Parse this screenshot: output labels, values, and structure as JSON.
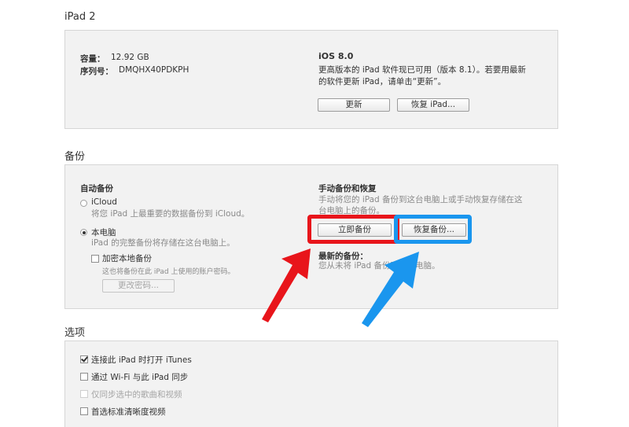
{
  "device": {
    "title": "iPad 2",
    "capacity_label": "容量：",
    "capacity_value": "12.92 GB",
    "serial_label": "序列号：",
    "serial_value": "DMQHX40PDKPH",
    "ios_version": "iOS 8.0",
    "update_msg_line1": "更高版本的 iPad 软件现已可用（版本 8.1）。若要用最新",
    "update_msg_line2": "的软件更新 iPad，请单击“更新”。",
    "update_button": "更新",
    "restore_button": "恢复 iPad..."
  },
  "backup": {
    "title": "备份",
    "auto_title": "自动备份",
    "icloud_label": "iCloud",
    "icloud_desc": "将您 iPad 上最重要的数据备份到 iCloud。",
    "computer_label": "本电脑",
    "computer_desc": "iPad 的完整备份将存储在这台电脑上。",
    "encrypt_label": "加密本地备份",
    "encrypt_desc": "这也将备份在此 iPad 上使用的账户密码。",
    "change_password_button": "更改密码...",
    "manual_title": "手动备份和恢复",
    "manual_desc_line1": "手动将您的 iPad 备份到这台电脑上或手动恢复存储在这",
    "manual_desc_line2": "台电脑上的备份。",
    "backup_now_button": "立即备份",
    "restore_backup_button": "恢复备份...",
    "latest_title": "最新的备份：",
    "latest_desc": "您从未将 iPad 备份到这台电脑。"
  },
  "options": {
    "title": "选项",
    "items": [
      {
        "label": "连接此 iPad 时打开 iTunes",
        "checked": true,
        "disabled": false
      },
      {
        "label": "通过 Wi-Fi 与此 iPad 同步",
        "checked": false,
        "disabled": false
      },
      {
        "label": "仅同步选中的歌曲和视频",
        "checked": false,
        "disabled": true
      },
      {
        "label": "首选标准清晰度视频",
        "checked": false,
        "disabled": false
      }
    ]
  },
  "annotations": {
    "red_color": "#e8151b",
    "blue_color": "#1a96ee"
  }
}
